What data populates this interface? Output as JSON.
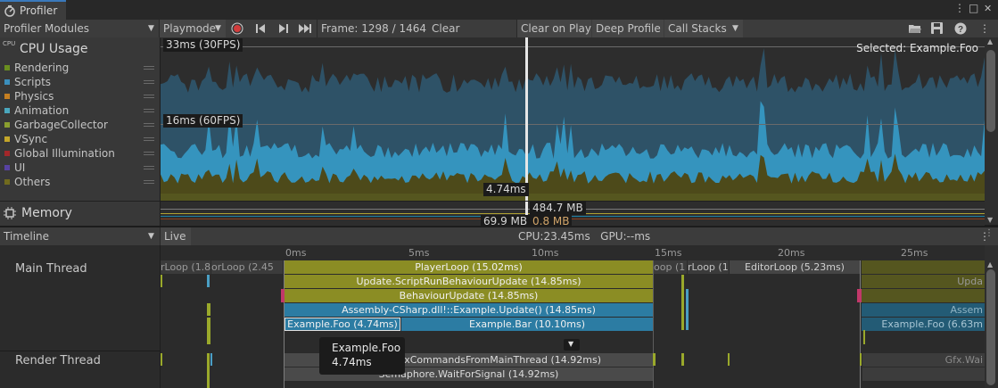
{
  "window": {
    "tab_title": "Profiler",
    "menu_glyph": "⋮",
    "max_glyph": "□",
    "close_glyph": "✕"
  },
  "toolbar": {
    "modules_label": "Profiler Modules",
    "playmode_label": "Playmode",
    "frame_label": "Frame: 1298 / 1464",
    "clear_label": "Clear",
    "clear_on_play_label": "Clear on Play",
    "deep_profile_label": "Deep Profile",
    "call_stacks_label": "Call Stacks"
  },
  "cpu_module": {
    "title": "CPU Usage",
    "icon_text": "CPU",
    "legend": [
      {
        "name": "Rendering",
        "color": "#6a8e1f"
      },
      {
        "name": "Scripts",
        "color": "#3b8fbd"
      },
      {
        "name": "Physics",
        "color": "#c67f21"
      },
      {
        "name": "Animation",
        "color": "#4aa7bd"
      },
      {
        "name": "GarbageCollector",
        "color": "#8a9e2f"
      },
      {
        "name": "VSync",
        "color": "#c3a62a"
      },
      {
        "name": "Global Illumination",
        "color": "#a3272a"
      },
      {
        "name": "UI",
        "color": "#5742a2"
      },
      {
        "name": "Others",
        "color": "#716b1e"
      }
    ],
    "line_30fps": "33ms (30FPS)",
    "line_60fps": "16ms (60FPS)",
    "selected_label": "Selected: Example.Foo",
    "cursor_value": "4.74ms"
  },
  "memory_module": {
    "title": "Memory",
    "value_a": "484.7 MB",
    "value_b": "69.9 MB",
    "value_c": "0.8 MB"
  },
  "timeline": {
    "view_label": "Timeline",
    "live_label": "Live",
    "cpu_gpu": "CPU:23.45ms   GPU:--ms",
    "ticks": [
      "0ms",
      "5ms",
      "10ms",
      "15ms",
      "20ms",
      "25ms"
    ],
    "main_thread_label": "Main Thread",
    "render_thread_label": "Render Thread",
    "samples": {
      "left_1": "rLoop (1.8",
      "left_2": "orLoop (2.45",
      "playerloop": "PlayerLoop (15.02ms)",
      "right_1": "oop (1",
      "right_2": "rLoop (1.7",
      "editorloop": "EditorLoop (5.23ms)",
      "update_script": "Update.ScriptRunBehaviourUpdate (14.85ms)",
      "update_right": "Upda",
      "behaviour_update": "BehaviourUpdate (14.85ms)",
      "assembly": "Assembly-CSharp.dll!::Example.Update() (14.85ms)",
      "assembly_right": "Assem",
      "foo": "Example.Foo (4.74ms)",
      "bar": "Example.Bar (10.10ms)",
      "foo_right": "Example.Foo (6.63m",
      "gfx": "Gfx.WaitForGfxCommandsFromMainThread (14.92ms)",
      "gfx_right": "Gfx.Wai",
      "semaphore": "Semaphore.WaitForSignal (14.92ms)"
    },
    "tooltip": {
      "name": "Example.Foo",
      "time": "4.74ms"
    }
  },
  "colors": {
    "rendering": "#6a8e1f",
    "scripts": "#3b8fbd",
    "others": "#716b1e",
    "playerloop": "#8b8d24",
    "scripts_bar": "#2c7ca3",
    "gray_bar": "#4a4a4a",
    "accent_blue": "#3a79bb"
  }
}
